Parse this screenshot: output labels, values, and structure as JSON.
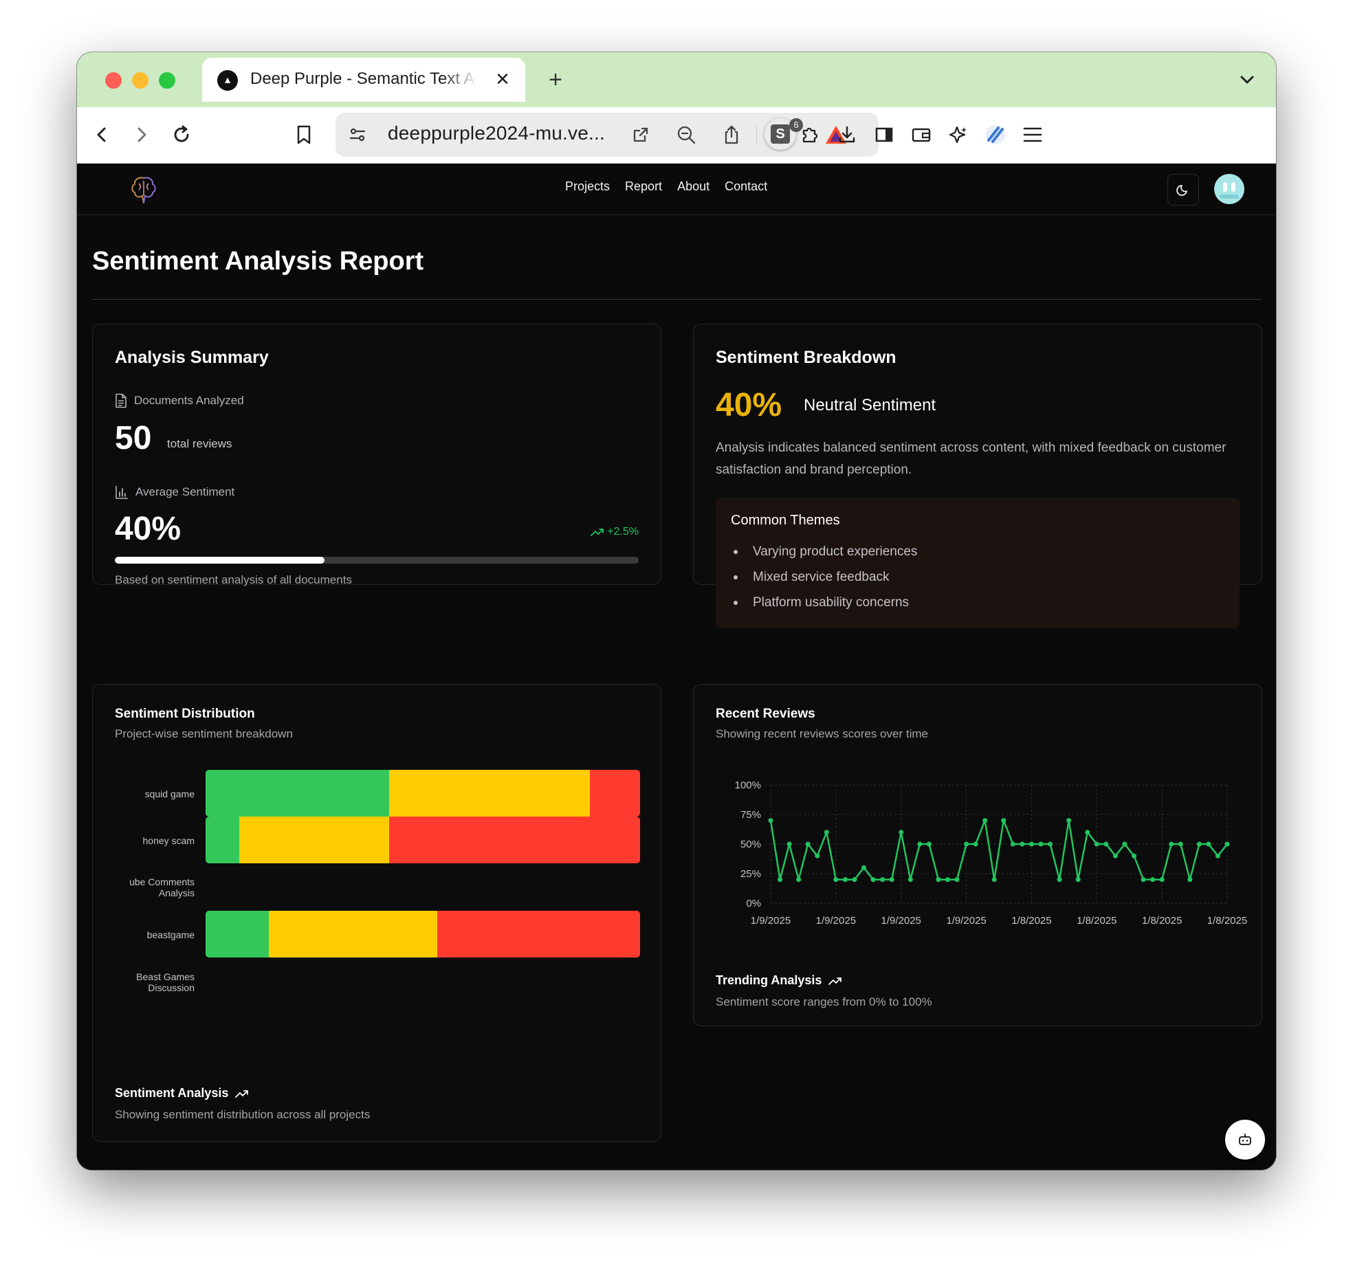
{
  "browser": {
    "tab_title": "Deep Purple - Semantic Text Analysis",
    "new_tab_label": "+",
    "url": "deeppurple2024-mu.ve...",
    "shield_count": "6"
  },
  "nav": {
    "links": [
      "Projects",
      "Report",
      "About",
      "Contact"
    ]
  },
  "page": {
    "title": "Sentiment Analysis Report"
  },
  "summary": {
    "title": "Analysis Summary",
    "documents_label": "Documents Analyzed",
    "documents_value": "50",
    "documents_unit": "total reviews",
    "avg_label": "Average Sentiment",
    "avg_value": "40%",
    "trend": "+2.5%",
    "progress": 0.4,
    "footnote": "Based on sentiment analysis of all documents"
  },
  "breakdown": {
    "title": "Sentiment Breakdown",
    "percent": "40%",
    "label": "Neutral Sentiment",
    "description": "Analysis indicates balanced sentiment across content, with mixed feedback on customer satisfaction and brand perception.",
    "themes_title": "Common Themes",
    "themes": [
      "Varying product experiences",
      "Mixed service feedback",
      "Platform usability concerns"
    ]
  },
  "distribution": {
    "title": "Sentiment Distribution",
    "subtitle": "Project-wise sentiment breakdown",
    "footer_title": "Sentiment Analysis",
    "footer_sub": "Showing sentiment distribution across all projects",
    "colors": {
      "positive": "#34c759",
      "neutral": "#ffcc00",
      "negative": "#ff3b30"
    },
    "projects": [
      {
        "name": "squid game",
        "positive": 42.3,
        "neutral": 46.2,
        "negative": 11.5
      },
      {
        "name": "honey scam",
        "positive": 7.7,
        "neutral": 34.6,
        "negative": 57.7
      },
      {
        "name": "ube Comments Analysis",
        "positive": 0,
        "neutral": 0,
        "negative": 0
      },
      {
        "name": "beastgame",
        "positive": 14.6,
        "neutral": 38.8,
        "negative": 46.6
      },
      {
        "name": "Beast Games Discussion",
        "positive": 0,
        "neutral": 0,
        "negative": 0
      }
    ]
  },
  "reviews": {
    "title": "Recent Reviews",
    "subtitle": "Showing recent reviews scores over time",
    "footer_title": "Trending Analysis",
    "footer_sub": "Sentiment score ranges from 0% to 100%"
  },
  "chart_data": {
    "type": "line",
    "title": "Recent Reviews",
    "y_ticks": [
      "100%",
      "75%",
      "50%",
      "25%",
      "0%"
    ],
    "x_ticks": [
      "1/9/2025",
      "1/9/2025",
      "1/9/2025",
      "1/9/2025",
      "1/8/2025",
      "1/8/2025",
      "1/8/2025",
      "1/8/2025"
    ],
    "ylim": [
      0,
      100
    ],
    "color": "#22c55e",
    "grid": true,
    "values": [
      70,
      20,
      50,
      20,
      50,
      40,
      60,
      20,
      20,
      20,
      30,
      20,
      20,
      20,
      60,
      20,
      50,
      50,
      20,
      20,
      20,
      50,
      50,
      70,
      20,
      70,
      50,
      50,
      50,
      50,
      50,
      20,
      70,
      20,
      60,
      50,
      50,
      40,
      50,
      40,
      20,
      20,
      20,
      50,
      50,
      20,
      50,
      50,
      40,
      50
    ]
  }
}
